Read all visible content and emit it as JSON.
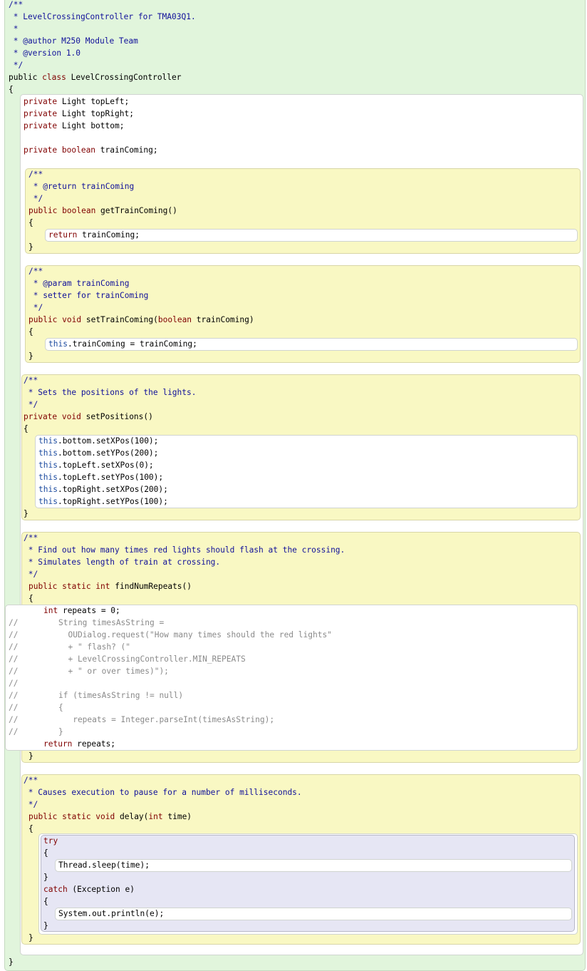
{
  "editor": {
    "class_javadoc": {
      "open": "/**",
      "line1": " * LevelCrossingController for TMA03Q1.",
      "line2": " *",
      "line3": " * @author M250 Module Team",
      "line4": " * @version 1.0",
      "close": " */"
    },
    "class_header": {
      "mod": "public ",
      "kw": "class",
      "name": " LevelCrossingController"
    },
    "class_open_brace": "{",
    "class_close_brace": "}",
    "fields": [
      {
        "mod": "private",
        "type": " Light",
        "name": " topLeft;"
      },
      {
        "mod": "private",
        "type": " Light",
        "name": " topRight;"
      },
      {
        "mod": "private",
        "type": " Light",
        "name": " bottom;"
      }
    ],
    "field_train": {
      "mod": "private",
      "type": " boolean",
      "name": " trainComing;"
    },
    "getter": {
      "doc_open": "/**",
      "doc1": " * @return trainComing",
      "doc_close": " */",
      "sig_mod": "public ",
      "sig_type": "boolean",
      "sig_name": " getTrainComing()",
      "open": "{",
      "body_kw": "return",
      "body_rest": " trainComing;",
      "close": "}"
    },
    "setter": {
      "doc_open": "/**",
      "doc1": " * @param trainComing",
      "doc2": " * setter for trainComing",
      "doc_close": " */",
      "sig_mod": "public ",
      "sig_type": "void",
      "sig_name": " setTrainComing(",
      "sig_ptype": "boolean",
      "sig_pname": " trainComing)",
      "open": "{",
      "body_this": "this",
      "body_rest": ".trainComing = trainComing;",
      "close": "}"
    },
    "positions": {
      "doc_open": "/**",
      "doc1": " * Sets the positions of the lights.",
      "doc_close": " */",
      "sig_mod": "private",
      "sig_type": " void",
      "sig_name": " setPositions()",
      "open": "{",
      "body": [
        {
          "t": "this",
          "r": ".bottom.setXPos(100);"
        },
        {
          "t": "this",
          "r": ".bottom.setYPos(200);"
        },
        {
          "t": "this",
          "r": ".topLeft.setXPos(0);"
        },
        {
          "t": "this",
          "r": ".topLeft.setYPos(100);"
        },
        {
          "t": "this",
          "r": ".topRight.setXPos(200);"
        },
        {
          "t": "this",
          "r": ".topRight.setYPos(100);"
        }
      ],
      "close": "}"
    },
    "repeats": {
      "doc_open": "/**",
      "doc1": " * Find out how many times red lights should flash at the crossing.",
      "doc2": " * Simulates length of train at crossing.",
      "doc_close": " */",
      "sig_mod": "public static ",
      "sig_type": "int",
      "sig_name": " findNumRepeats()",
      "open": "{",
      "decl_type": "int",
      "decl_rest": " repeats = 0;",
      "commented": [
        {
          "slash": "//",
          "code": "String timesAsString ="
        },
        {
          "slash": "//",
          "code": "  OUDialog.request(\"How many times should the red lights\""
        },
        {
          "slash": "//",
          "code": "  + \" flash? (\""
        },
        {
          "slash": "//",
          "code": "  + LevelCrossingController.MIN_REPEATS"
        },
        {
          "slash": "//",
          "code": "  + \" or over times)\");"
        },
        {
          "slash": "//",
          "code": ""
        },
        {
          "slash": "//",
          "code": "if (timesAsString != null)"
        },
        {
          "slash": "//",
          "code": "{"
        },
        {
          "slash": "//",
          "code": "   repeats = Integer.parseInt(timesAsString);"
        },
        {
          "slash": "//",
          "code": "}"
        }
      ],
      "ret_kw": "return",
      "ret_rest": " repeats;",
      "close": "}"
    },
    "delay": {
      "doc_open": "/**",
      "doc1": " * Causes execution to pause for a number of milliseconds.",
      "doc_close": " */",
      "sig_mod": "public static ",
      "sig_type": "void",
      "sig_name": " delay(",
      "sig_ptype": "int",
      "sig_pname": " time)",
      "open": "{",
      "try_kw": "try",
      "try_open": "{",
      "try_body": "Thread.sleep(time);",
      "try_close": "}",
      "catch_kw": "catch",
      "catch_rest": " (Exception e)",
      "catch_open": "{",
      "catch_body": "System.out.println(e);",
      "catch_close": "}",
      "close": "}"
    }
  }
}
